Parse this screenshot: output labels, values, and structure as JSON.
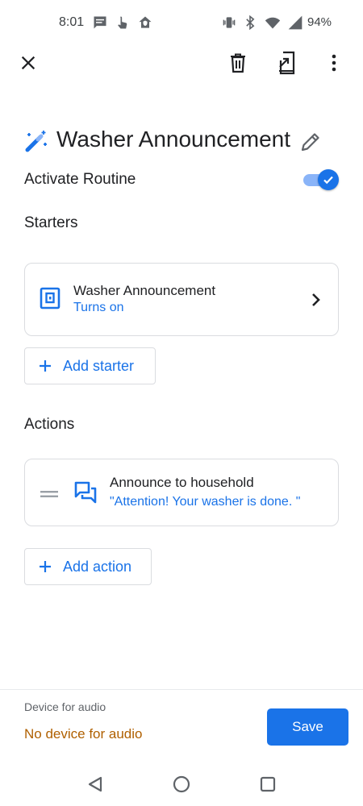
{
  "status_bar": {
    "time": "8:01",
    "battery": "94%",
    "left_icons": [
      "message-icon",
      "touch-icon",
      "home-shield-icon"
    ],
    "right_icons": [
      "vibrate-icon",
      "bluetooth-icon",
      "wifi-icon",
      "signal-icon"
    ]
  },
  "toolbar": {
    "close_icon": "close-icon",
    "delete_icon": "trash-icon",
    "cast_icon": "cast-to-device-icon",
    "more_icon": "more-vert-icon"
  },
  "routine": {
    "title": "Washer Announcement",
    "icon": "magic-wand-icon",
    "edit_icon": "pencil-icon",
    "activate_label": "Activate Routine",
    "activate_on": true
  },
  "starters": {
    "heading": "Starters",
    "item": {
      "title": "Washer Announcement",
      "subtitle": "Turns on",
      "icon": "washer-device-icon"
    },
    "add_label": "Add starter"
  },
  "actions": {
    "heading": "Actions",
    "item": {
      "title": "Announce to household",
      "subtitle": "\"Attention! Your washer is done. \"",
      "icon": "announce-icon"
    },
    "add_label": "Add action"
  },
  "footer": {
    "audio_label": "Device for audio",
    "audio_value": "No device for audio",
    "save_label": "Save"
  },
  "colors": {
    "accent": "#1a73e8",
    "accent_light": "#8ab4f8",
    "warning_text": "#b06000",
    "border": "#dadce0"
  }
}
